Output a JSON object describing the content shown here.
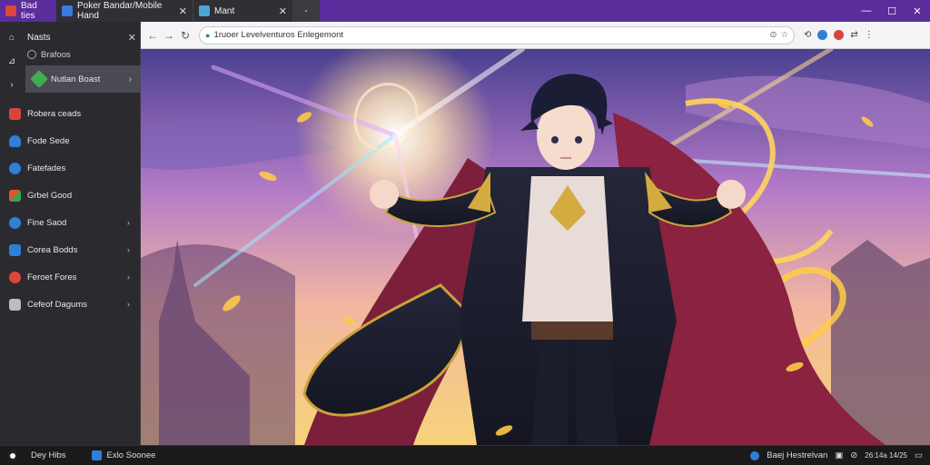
{
  "tabs": [
    {
      "label": "Bad ties",
      "favicon_color": "#e0453a",
      "active": false
    },
    {
      "label": "Poker Bandar/Mobile Hand",
      "favicon_color": "#3a7be0",
      "active": true
    },
    {
      "label": "Mant",
      "favicon_color": "#49a6d6",
      "active": true
    },
    {
      "label": "-",
      "favicon_color": "",
      "active": false
    }
  ],
  "window_controls": {
    "minimize": "—",
    "maximize": "☐",
    "close": "✕"
  },
  "sidebar": {
    "title": "Nasts",
    "subtitle": "Brafoos",
    "selected_label": "Nutlan Boast",
    "items": [
      {
        "label": "Robera ceads",
        "icon_color": "#d9443a",
        "chevron": false
      },
      {
        "label": "Fode Sede",
        "icon_color": "#2f7fd8",
        "chevron": false
      },
      {
        "label": "Fatefades",
        "icon_color": "#2f7fd8",
        "chevron": false
      },
      {
        "label": "Grbel Good",
        "icon_color": "#e0562c",
        "chevron": false
      },
      {
        "label": "Fine Saod",
        "icon_color": "#2f7fd8",
        "chevron": true
      },
      {
        "label": "Corea Bodds",
        "icon_color": "#2f7fd8",
        "chevron": true
      },
      {
        "label": "Feroet Fores",
        "icon_color": "#e0453a",
        "chevron": true
      },
      {
        "label": "Cefeof Dagums",
        "icon_color": "#bdbdbd",
        "chevron": true
      }
    ]
  },
  "toolbar": {
    "url": "1ruoer Levelventuros Enlegemont",
    "back_icon": "←",
    "forward_icon": "→",
    "reload_icon": "↻"
  },
  "content": {
    "image_description_hidden": ""
  },
  "statusbar": {
    "left_label": "Dey Hibs",
    "mid_label": "Exlo Soonee",
    "right_label": "Baej Hestrelvan",
    "clock": "26:14a 14/25"
  },
  "colors": {
    "accent": "#5b2d9c",
    "sidebar_bg": "#2b2b2f",
    "selected_bg": "#4a4a52"
  }
}
